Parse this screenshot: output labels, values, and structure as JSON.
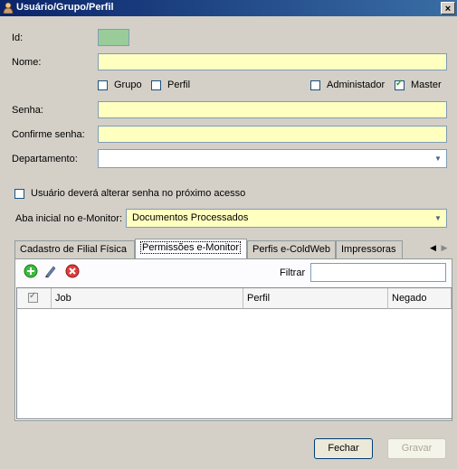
{
  "window": {
    "title": "Usuário/Grupo/Perfil",
    "close_label": "×"
  },
  "form": {
    "id_label": "Id:",
    "nome_label": "Nome:",
    "nome_value": "",
    "grupo_label": "Grupo",
    "perfil_label": "Perfil",
    "administrador_label": "Administador",
    "master_label": "Master",
    "master_checked": true,
    "senha_label": "Senha:",
    "confirme_label": "Confirme senha:",
    "departamento_label": "Departamento:",
    "departamento_value": "",
    "alterar_senha_label": "Usuário deverá alterar senha no próximo acesso",
    "aba_inicial_label": "Aba inicial no e-Monitor:",
    "aba_inicial_value": "Documentos Processados"
  },
  "tabs": [
    {
      "label": "Cadastro de Filial Física",
      "active": false
    },
    {
      "label": "Permissões e-Monitor",
      "active": true
    },
    {
      "label": "Perfis e-ColdWeb",
      "active": false
    },
    {
      "label": "Impressoras",
      "active": false
    }
  ],
  "panel": {
    "filter_label": "Filtrar",
    "filter_value": "",
    "columns": [
      "Job",
      "Perfil",
      "Negado"
    ],
    "rows": []
  },
  "buttons": {
    "fechar": "Fechar",
    "gravar": "Gravar"
  },
  "colors": {
    "field_yellow": "#ffffc0",
    "id_green": "#99cc99",
    "title_blue": "#0a246a"
  }
}
